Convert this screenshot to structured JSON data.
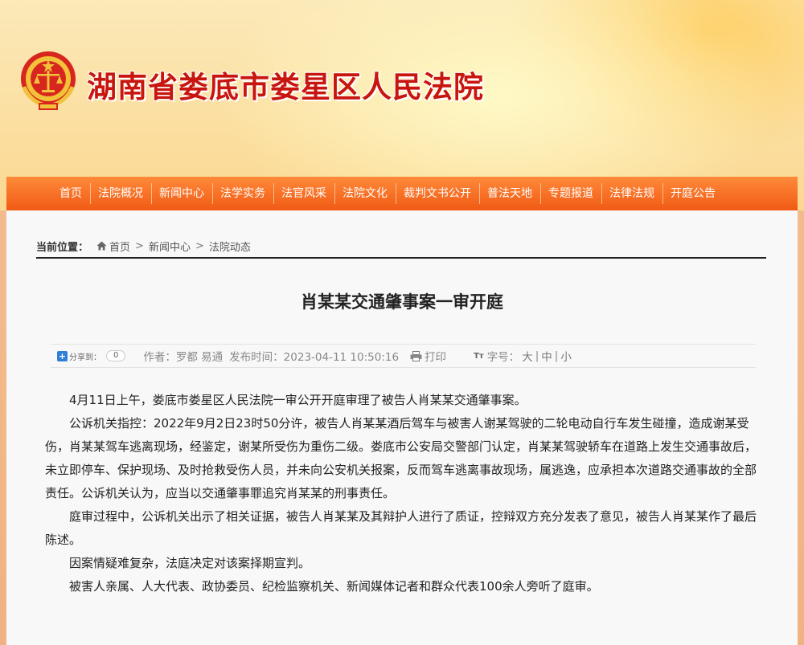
{
  "site": {
    "title": "湖南省娄底市娄星区人民法院"
  },
  "nav": {
    "items": [
      "首页",
      "法院概况",
      "新闻中心",
      "法学实务",
      "法官风采",
      "法院文化",
      "裁判文书公开",
      "普法天地",
      "专题报道",
      "法律法规",
      "开庭公告"
    ]
  },
  "breadcrumb": {
    "label": "当前位置：",
    "home": "首页",
    "level2": "新闻中心",
    "level3": "法院动态"
  },
  "article": {
    "title": "肖某某交通肇事案一审开庭",
    "share_label": "分享到：",
    "share_count": "0",
    "author": "作者：罗都 易通",
    "publish_time": "发布时间：2023-04-11 10:50:16",
    "print_label": "打印",
    "font_size_label": "字号：",
    "font_size_large": "大",
    "font_size_medium": "中",
    "font_size_small": "小",
    "separator": "|",
    "paragraphs": [
      "4月11日上午，娄底市娄星区人民法院一审公开开庭审理了被告人肖某某交通肇事案。",
      "公诉机关指控：2022年9月2日23时50分许，被告人肖某某酒后驾车与被害人谢某驾驶的二轮电动自行车发生碰撞，造成谢某受伤，肖某某驾车逃离现场，经鉴定，谢某所受伤为重伤二级。娄底市公安局交警部门认定，肖某某驾驶轿车在道路上发生交通事故后，未立即停车、保护现场、及时抢救受伤人员，并未向公安机关报案，反而驾车逃离事故现场，属逃逸，应承担本次道路交通事故的全部责任。公诉机关认为，应当以交通肇事罪追究肖某某的刑事责任。",
      "庭审过程中，公诉机关出示了相关证据，被告人肖某某及其辩护人进行了质证，控辩双方充分发表了意见，被告人肖某某作了最后陈述。",
      "因案情疑难复杂，法庭决定对该案择期宣判。",
      "被害人亲属、人大代表、政协委员、纪检监察机关、新闻媒体记者和群众代表100余人旁听了庭审。"
    ]
  },
  "colors": {
    "title_red": "#c8160f",
    "nav_orange": "#f05a14"
  },
  "icons": [
    "court-emblem-icon",
    "home-icon",
    "share-plus-icon",
    "print-icon",
    "font-size-icon"
  ]
}
